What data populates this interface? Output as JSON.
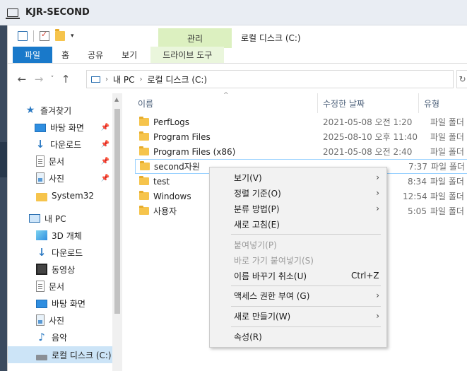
{
  "window": {
    "title": "KJR-SECOND"
  },
  "quick_access": {
    "path_title": "로컬 디스크 (C:)",
    "manage_label": "관리"
  },
  "ribbon": {
    "tabs": [
      {
        "label": "파일"
      },
      {
        "label": "홈"
      },
      {
        "label": "공유"
      },
      {
        "label": "보기"
      },
      {
        "label": "드라이브 도구"
      }
    ]
  },
  "address": {
    "segments": [
      "내 PC",
      "로컬 디스크 (C:)"
    ]
  },
  "nav_pane": {
    "items": [
      {
        "label": "즐겨찾기",
        "icon": "star-icon"
      },
      {
        "label": "바탕 화면",
        "icon": "desktop-icon",
        "pinned": true
      },
      {
        "label": "다운로드",
        "icon": "download-icon",
        "pinned": true
      },
      {
        "label": "문서",
        "icon": "documents-icon",
        "pinned": true
      },
      {
        "label": "사진",
        "icon": "pictures-icon",
        "pinned": true
      },
      {
        "label": "System32",
        "icon": "folder-icon"
      },
      {
        "label": "내 PC",
        "icon": "pc-icon"
      },
      {
        "label": "3D 개체",
        "icon": "3d-objects-icon"
      },
      {
        "label": "다운로드",
        "icon": "download-icon"
      },
      {
        "label": "동영상",
        "icon": "video-icon"
      },
      {
        "label": "문서",
        "icon": "documents-icon"
      },
      {
        "label": "바탕 화면",
        "icon": "desktop-icon"
      },
      {
        "label": "사진",
        "icon": "pictures-icon"
      },
      {
        "label": "음악",
        "icon": "music-icon"
      },
      {
        "label": "로컬 디스크 (C:)",
        "icon": "drive-icon"
      }
    ]
  },
  "file_list": {
    "columns": {
      "name": "이름",
      "modified": "수정한 날짜",
      "type": "유형"
    },
    "rows": [
      {
        "name": "PerfLogs",
        "date": "2021-05-08 오전 1:20",
        "type": "파일 폴더"
      },
      {
        "name": "Program Files",
        "date": "2025-08-10 오후 11:40",
        "type": "파일 폴더"
      },
      {
        "name": "Program Files (x86)",
        "date": "2021-05-08 오전 2:40",
        "type": "파일 폴더"
      },
      {
        "name": "second자원",
        "date": "7:37",
        "type": "파일 폴더"
      },
      {
        "name": "test",
        "date": "8:34",
        "type": "파일 폴더"
      },
      {
        "name": "Windows",
        "date": "12:54",
        "type": "파일 폴더"
      },
      {
        "name": "사용자",
        "date": "5:05",
        "type": "파일 폴더"
      }
    ]
  },
  "context_menu": {
    "items": [
      {
        "label": "보기(V)",
        "submenu": true
      },
      {
        "label": "정렬 기준(O)",
        "submenu": true
      },
      {
        "label": "분류 방법(P)",
        "submenu": true
      },
      {
        "label": "새로 고침(E)"
      },
      {
        "label": "붙여넣기(P)",
        "disabled": true
      },
      {
        "label": "바로 가기 붙여넣기(S)",
        "disabled": true
      },
      {
        "label": "이름 바꾸기 취소(U)",
        "shortcut": "Ctrl+Z"
      },
      {
        "label": "액세스 권한 부여 (G)",
        "submenu": true
      },
      {
        "label": "새로 만들기(W)",
        "submenu": true
      },
      {
        "label": "속성(R)"
      }
    ]
  }
}
